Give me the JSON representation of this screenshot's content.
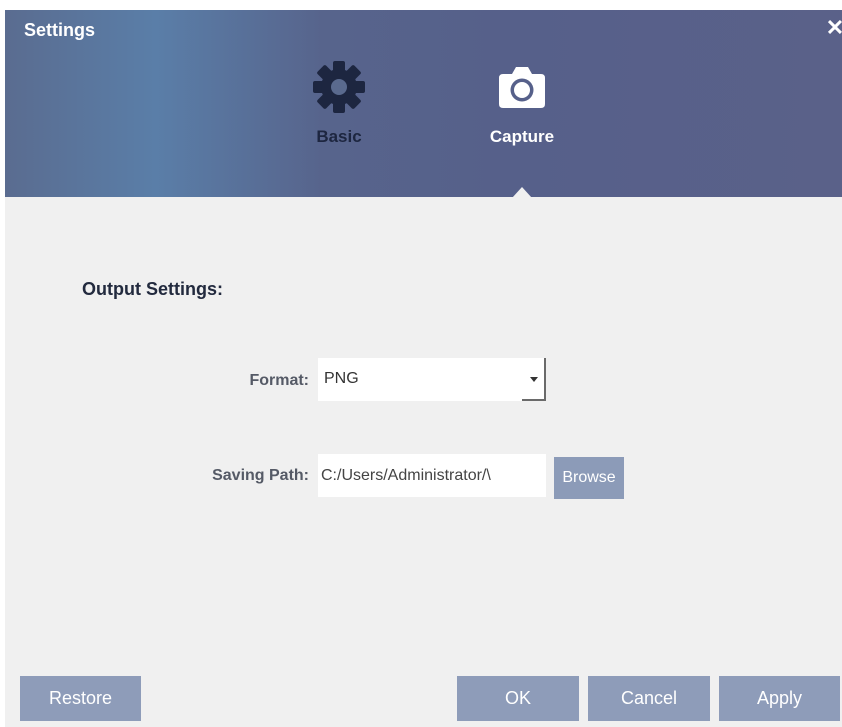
{
  "window": {
    "title": "Settings",
    "close_symbol": "✕"
  },
  "tabs": [
    {
      "label": "Basic",
      "icon": "gear-icon",
      "active": false
    },
    {
      "label": "Capture",
      "icon": "camera-icon",
      "active": true
    }
  ],
  "output": {
    "section_title": "Output Settings:",
    "format_label": "Format:",
    "format_value": "PNG",
    "path_label": "Saving Path:",
    "path_value": "C:/Users/Administrator/\\",
    "browse_label": "Browse"
  },
  "footer": {
    "restore_label": "Restore",
    "ok_label": "OK",
    "cancel_label": "Cancel",
    "apply_label": "Apply"
  },
  "colors": {
    "header_dark": "#56608a",
    "header_light": "#5a7ea8",
    "button": "#8e9cb9",
    "background": "#f0f0f0"
  }
}
